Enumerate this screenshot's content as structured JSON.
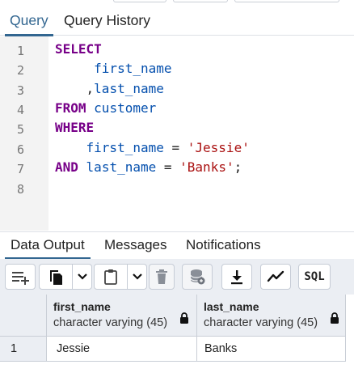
{
  "editor_tabs": [
    "Query",
    "Query History"
  ],
  "active_editor_tab": "Query",
  "editor": {
    "line_numbers": [
      "1",
      "2",
      "3",
      "4",
      "5",
      "6",
      "7",
      "8"
    ],
    "lines": [
      [
        {
          "t": "kw",
          "v": "SELECT"
        }
      ],
      [
        {
          "t": "id",
          "v": "     first_name"
        }
      ],
      [
        {
          "t": "op",
          "v": "    ,"
        },
        {
          "t": "id",
          "v": "last_name"
        }
      ],
      [
        {
          "t": "kw",
          "v": "FROM"
        },
        {
          "t": "op",
          "v": " "
        },
        {
          "t": "id",
          "v": "customer"
        }
      ],
      [
        {
          "t": "kw",
          "v": "WHERE"
        }
      ],
      [
        {
          "t": "id",
          "v": "    first_name"
        },
        {
          "t": "op",
          "v": " = "
        },
        {
          "t": "str",
          "v": "'Jessie'"
        }
      ],
      [
        {
          "t": "kw",
          "v": "AND"
        },
        {
          "t": "op",
          "v": " "
        },
        {
          "t": "id",
          "v": "last_name"
        },
        {
          "t": "op",
          "v": " = "
        },
        {
          "t": "str",
          "v": "'Banks'"
        },
        {
          "t": "op",
          "v": ";"
        }
      ],
      []
    ]
  },
  "output_tabs": [
    "Data Output",
    "Messages",
    "Notifications"
  ],
  "active_output_tab": "Data Output",
  "toolbar": {
    "buttons": [
      {
        "name": "add-row-button",
        "icon": "add-row-icon"
      },
      {
        "name": "copy-button",
        "icon": "copy-icon"
      },
      {
        "name": "copy-options-dropdown",
        "icon": "chevron-down-icon"
      },
      {
        "name": "paste-button",
        "icon": "paste-icon"
      },
      {
        "name": "paste-options-dropdown",
        "icon": "chevron-down-icon"
      },
      {
        "name": "delete-button",
        "icon": "trash-icon"
      },
      {
        "name": "save-data-button",
        "icon": "database-save-icon"
      },
      {
        "name": "download-button",
        "icon": "download-icon"
      },
      {
        "name": "graph-button",
        "icon": "line-chart-icon"
      },
      {
        "name": "sql-button",
        "icon": "sql-icon",
        "label": "SQL"
      }
    ]
  },
  "results": {
    "columns": [
      {
        "name": "first_name",
        "type": "character varying (45)"
      },
      {
        "name": "last_name",
        "type": "character varying (45)"
      }
    ],
    "rows": [
      {
        "num": "1",
        "cells": [
          "Jessie",
          "Banks"
        ]
      }
    ]
  },
  "colors": {
    "accent": "#326690",
    "keyword": "#770088",
    "identifier": "#0550ae",
    "string": "#aa1111"
  }
}
